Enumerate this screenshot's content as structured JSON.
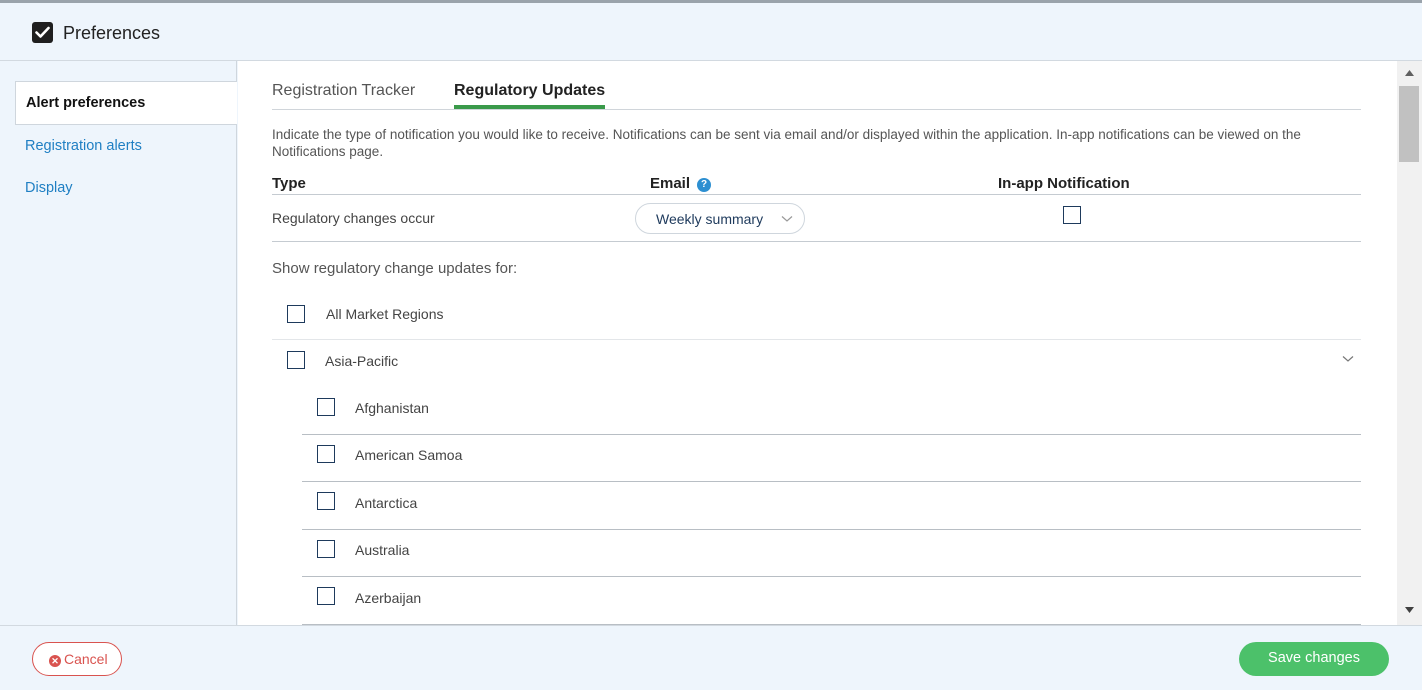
{
  "header": {
    "title": "Preferences"
  },
  "sidebar": {
    "items": [
      {
        "label": "Alert preferences"
      },
      {
        "label": "Registration alerts"
      },
      {
        "label": "Display"
      }
    ]
  },
  "tabs": [
    {
      "label": "Registration Tracker"
    },
    {
      "label": "Regulatory Updates"
    }
  ],
  "description": "Indicate the type of notification you would like to receive. Notifications can be sent via email and/or displayed within the application. In-app notifications can be viewed on the Notifications page.",
  "table": {
    "headers": {
      "type": "Type",
      "email": "Email",
      "inapp": "In-app Notification"
    },
    "row": {
      "label": "Regulatory changes occur",
      "email_value": "Weekly summary",
      "inapp_checked": false
    }
  },
  "regions": {
    "label": "Show regulatory change updates for:",
    "all_label": "All Market Regions",
    "group_label": "Asia-Pacific",
    "countries": [
      "Afghanistan",
      "American Samoa",
      "Antarctica",
      "Australia",
      "Azerbaijan"
    ]
  },
  "footer": {
    "cancel_label": "Cancel",
    "save_label": "Save changes"
  },
  "colors": {
    "accent_green": "#4cc16a",
    "tab_underline": "#3a9a4a",
    "link_blue": "#1f7fc3",
    "cancel_red": "#d9534f"
  }
}
